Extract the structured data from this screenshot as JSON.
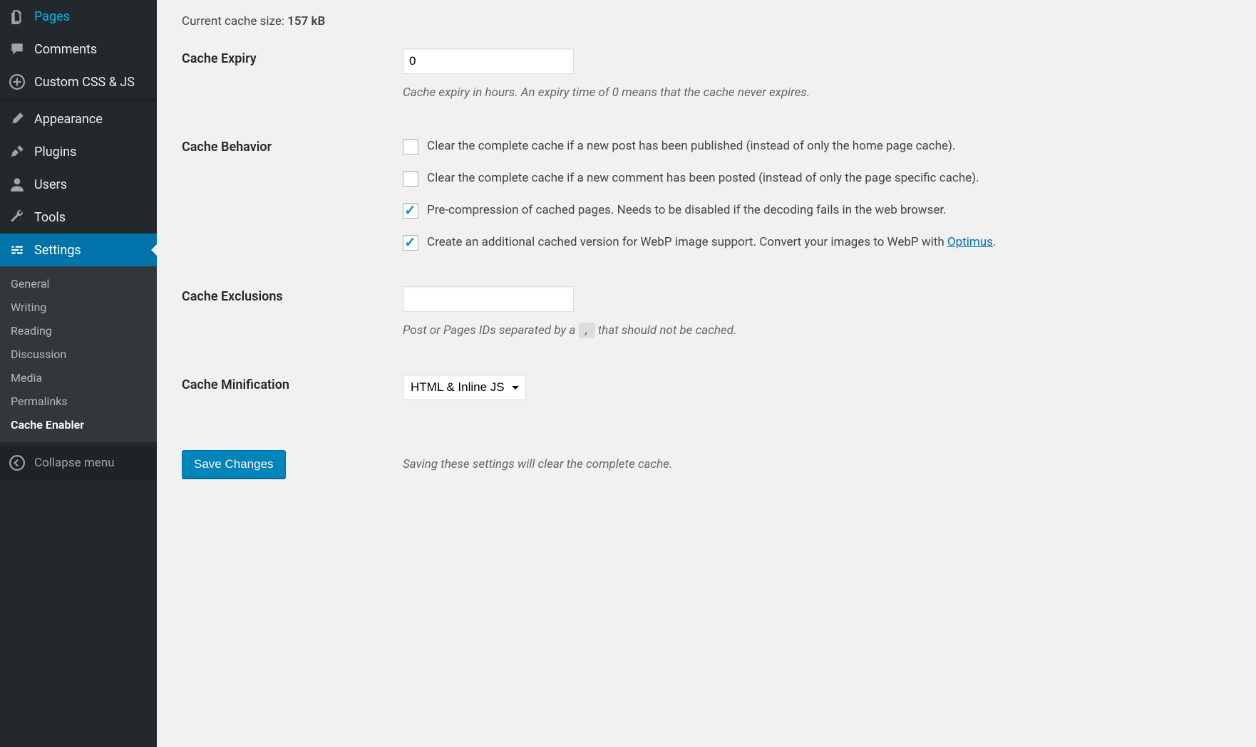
{
  "sidebar": {
    "items": [
      {
        "label": "Pages",
        "icon": "pages-icon"
      },
      {
        "label": "Comments",
        "icon": "comment-icon"
      },
      {
        "label": "Custom CSS & JS",
        "icon": "plus-circle-icon"
      }
    ],
    "items2": [
      {
        "label": "Appearance",
        "icon": "brush-icon"
      },
      {
        "label": "Plugins",
        "icon": "plug-icon"
      },
      {
        "label": "Users",
        "icon": "user-icon"
      },
      {
        "label": "Tools",
        "icon": "wrench-icon"
      },
      {
        "label": "Settings",
        "icon": "sliders-icon"
      }
    ],
    "submenu": [
      {
        "label": "General"
      },
      {
        "label": "Writing"
      },
      {
        "label": "Reading"
      },
      {
        "label": "Discussion"
      },
      {
        "label": "Media"
      },
      {
        "label": "Permalinks"
      },
      {
        "label": "Cache Enabler"
      }
    ],
    "collapse_label": "Collapse menu"
  },
  "main": {
    "cache_size_prefix": "Current cache size: ",
    "cache_size_value": "157 kB",
    "rows": {
      "expiry": {
        "label": "Cache Expiry",
        "value": "0",
        "desc": "Cache expiry in hours. An expiry time of 0 means that the cache never expires."
      },
      "behavior": {
        "label": "Cache Behavior",
        "opt1": {
          "checked": false,
          "text": "Clear the complete cache if a new post has been published (instead of only the home page cache)."
        },
        "opt2": {
          "checked": false,
          "text": "Clear the complete cache if a new comment has been posted (instead of only the page specific cache)."
        },
        "opt3": {
          "checked": true,
          "text": "Pre-compression of cached pages. Needs to be disabled if the decoding fails in the web browser."
        },
        "opt4": {
          "checked": true,
          "text_prefix": "Create an additional cached version for WebP image support. Convert your images to WebP with ",
          "link_text": "Optimus",
          "text_suffix": "."
        }
      },
      "exclusions": {
        "label": "Cache Exclusions",
        "value": "",
        "desc_prefix": "Post or Pages IDs separated by a ",
        "desc_code": ",",
        "desc_suffix": " that should not be cached."
      },
      "minification": {
        "label": "Cache Minification",
        "selected": "HTML & Inline JS"
      }
    },
    "save": {
      "button_label": "Save Changes",
      "desc": "Saving these settings will clear the complete cache."
    }
  }
}
